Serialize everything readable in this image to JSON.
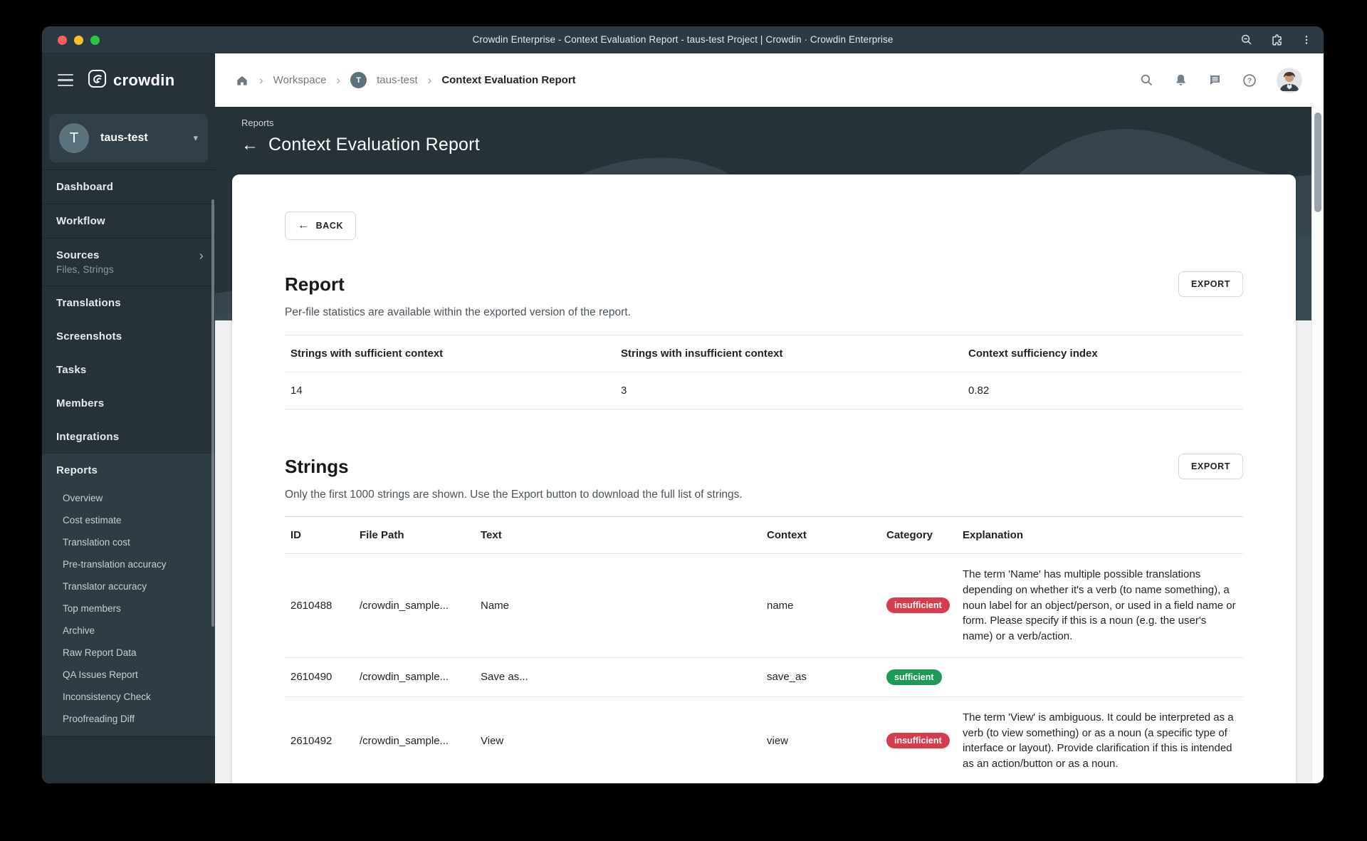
{
  "window": {
    "title": "Crowdin Enterprise - Context Evaluation Report - taus-test Project | Crowdin · Crowdin Enterprise"
  },
  "brand": {
    "wordmark": "crowdin"
  },
  "topbar": {
    "breadcrumb": {
      "workspace": "Workspace",
      "project": "taus-test",
      "project_initial": "T",
      "page": "Context Evaluation Report"
    }
  },
  "sidebar": {
    "project": {
      "name": "taus-test",
      "initial": "T",
      "caret": "▾"
    },
    "items": [
      {
        "label": "Dashboard"
      },
      {
        "label": "Workflow"
      },
      {
        "label": "Sources",
        "subtitle": "Files, Strings",
        "chevron": "›"
      },
      {
        "label": "Translations"
      },
      {
        "label": "Screenshots"
      },
      {
        "label": "Tasks"
      },
      {
        "label": "Members"
      },
      {
        "label": "Integrations"
      }
    ],
    "reports": {
      "label": "Reports",
      "children": [
        "Overview",
        "Cost estimate",
        "Translation cost",
        "Pre-translation accuracy",
        "Translator accuracy",
        "Top members",
        "Archive",
        "Raw Report Data",
        "QA Issues Report",
        "Inconsistency Check",
        "Proofreading Diff"
      ]
    }
  },
  "hero": {
    "eyebrow": "Reports",
    "back_arrow": "←",
    "title": "Context Evaluation Report"
  },
  "report_section": {
    "back_label": "BACK",
    "back_arrow": "←",
    "title": "Report",
    "export_label": "EXPORT",
    "description": "Per-file statistics are available within the exported version of the report.",
    "stats": {
      "headers": [
        "Strings with sufficient context",
        "Strings with insufficient context",
        "Context sufficiency index"
      ],
      "values": [
        "14",
        "3",
        "0.82"
      ]
    }
  },
  "strings_section": {
    "title": "Strings",
    "export_label": "EXPORT",
    "description": "Only the first 1000 strings are shown. Use the Export button to download the full list of strings.",
    "table": {
      "headers": [
        "ID",
        "File Path",
        "Text",
        "Context",
        "Category",
        "Explanation"
      ],
      "rows": [
        {
          "id": "2610488",
          "file_path": "/crowdin_sample...",
          "text": "Name",
          "context": "name",
          "category": "insufficient",
          "explanation": "The term 'Name' has multiple possible translations depending on whether it's a verb (to name something), a noun label for an object/person, or used in a field name or form. Please specify if this is a noun (e.g. the user's name) or a verb/action."
        },
        {
          "id": "2610490",
          "file_path": "/crowdin_sample...",
          "text": "Save as...",
          "context": "save_as",
          "category": "sufficient",
          "explanation": ""
        },
        {
          "id": "2610492",
          "file_path": "/crowdin_sample...",
          "text": "View",
          "context": "view",
          "category": "insufficient",
          "explanation": "The term 'View' is ambiguous. It could be interpreted as a verb (to view something) or as a noun (a specific type of interface or layout). Provide clarification if this is intended as an action/button or as a noun."
        }
      ]
    }
  },
  "colors": {
    "insufficient_badge": "#d83b4c",
    "sufficient_badge": "#1d9a58",
    "sidebar_bg": "#263238",
    "titlebar_bg": "#2c3a43"
  }
}
